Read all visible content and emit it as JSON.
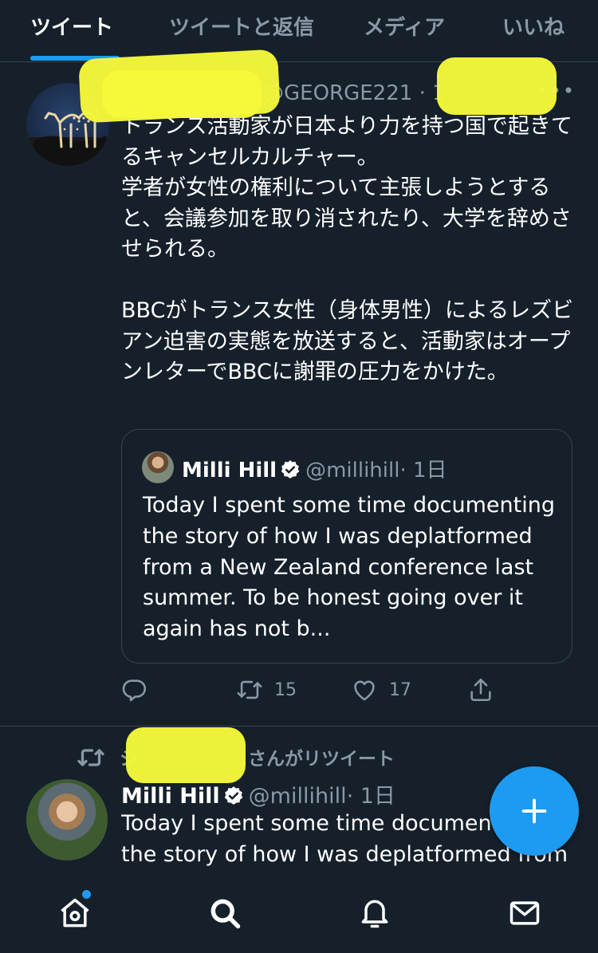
{
  "tabs": [
    {
      "label": "ツイート",
      "active": true
    },
    {
      "label": "ツイートと返信",
      "active": false
    },
    {
      "label": "メディア",
      "active": false
    },
    {
      "label": "いいね",
      "active": false
    }
  ],
  "tweet1": {
    "handle_visible": "@GEORGE221 · 1",
    "more": "•••",
    "text": "トランス活動家が日本より力を持つ国で起きてるキャンセルカルチャー。\n学者が女性の権利について主張しようとすると、会議参加を取り消されたり、大学を辞めさせられる。\n\nBBCがトランス女性（身体男性）によるレズビアン迫害の実態を放送すると、活動家はオープンレターでBBCに謝罪の圧力をかけた。",
    "quote": {
      "name": "Milli Hill",
      "handle": "@millihill",
      "time": "· 1日",
      "text": "Today I spent some time documenting the story of how I was deplatformed from a New Zealand conference last summer. To be honest going over it again has not b..."
    },
    "retweets": "15",
    "likes": "17"
  },
  "tweet2": {
    "retweeted_by_visible": "さんがリツイート",
    "retweeted_by_prefix": "シ",
    "name": "Milli Hill",
    "handle": "@millihill",
    "time": "· 1日",
    "text_line1": "Today I spent some time documenting",
    "text_line2": "the story of how I was deplatformed from"
  },
  "colors": {
    "background": "#15202b",
    "accent": "#1d9bf0",
    "secondary_text": "#8b98a5",
    "border": "#38444d",
    "redaction": "#f6f83a"
  },
  "icons": {
    "reply": "reply-icon",
    "retweet": "retweet-icon",
    "like": "heart-icon",
    "share": "share-icon",
    "verified": "verified-badge-icon",
    "compose": "plus-icon",
    "home": "home-icon",
    "search": "search-icon",
    "notifications": "bell-icon",
    "messages": "envelope-icon"
  }
}
